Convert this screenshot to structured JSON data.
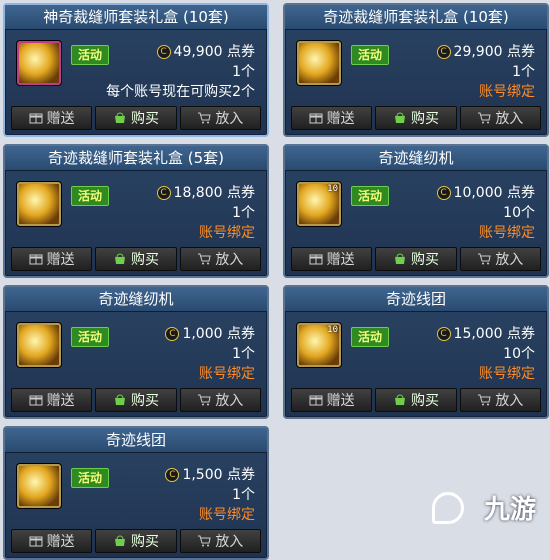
{
  "shop": {
    "items": [
      {
        "title": "神奇裁缝师套装礼盒 (10套)",
        "tag": "活动",
        "price": "49,900",
        "unit": "点券",
        "qty": "1个",
        "note": "每个账号现在可购买2个",
        "bind": "",
        "badge": "",
        "selected": true,
        "icon": "gift-box-icon"
      },
      {
        "title": "奇迹裁缝师套装礼盒 (10套)",
        "tag": "活动",
        "price": "29,900",
        "unit": "点券",
        "qty": "1个",
        "note": "",
        "bind": "账号绑定",
        "badge": "",
        "selected": false,
        "icon": "gift-box-icon"
      },
      {
        "title": "奇迹裁缝师套装礼盒 (5套)",
        "tag": "活动",
        "price": "18,800",
        "unit": "点券",
        "qty": "1个",
        "note": "",
        "bind": "账号绑定",
        "badge": "",
        "selected": false,
        "icon": "gift-box-icon"
      },
      {
        "title": "奇迹缝纫机",
        "tag": "活动",
        "price": "10,000",
        "unit": "点券",
        "qty": "10个",
        "note": "",
        "bind": "账号绑定",
        "badge": "10",
        "selected": false,
        "icon": "sewing-machine-icon"
      },
      {
        "title": "奇迹缝纫机",
        "tag": "活动",
        "price": "1,000",
        "unit": "点券",
        "qty": "1个",
        "note": "",
        "bind": "账号绑定",
        "badge": "",
        "selected": false,
        "icon": "sewing-machine-icon"
      },
      {
        "title": "奇迹线团",
        "tag": "活动",
        "price": "15,000",
        "unit": "点券",
        "qty": "10个",
        "note": "",
        "bind": "账号绑定",
        "badge": "10",
        "selected": false,
        "icon": "yarn-ball-icon"
      },
      {
        "title": "奇迹线团",
        "tag": "活动",
        "price": "1,500",
        "unit": "点券",
        "qty": "1个",
        "note": "",
        "bind": "账号绑定",
        "badge": "",
        "selected": false,
        "icon": "yarn-ball-icon"
      }
    ],
    "buttons": {
      "gift": "赠送",
      "buy": "购买",
      "cart": "放入"
    },
    "coin_symbol": "C"
  },
  "watermark": {
    "text": "九游"
  },
  "colors": {
    "accent": "#ff8c24",
    "tag_bg": "#2f8a22",
    "card_bg": "#2b4464"
  }
}
